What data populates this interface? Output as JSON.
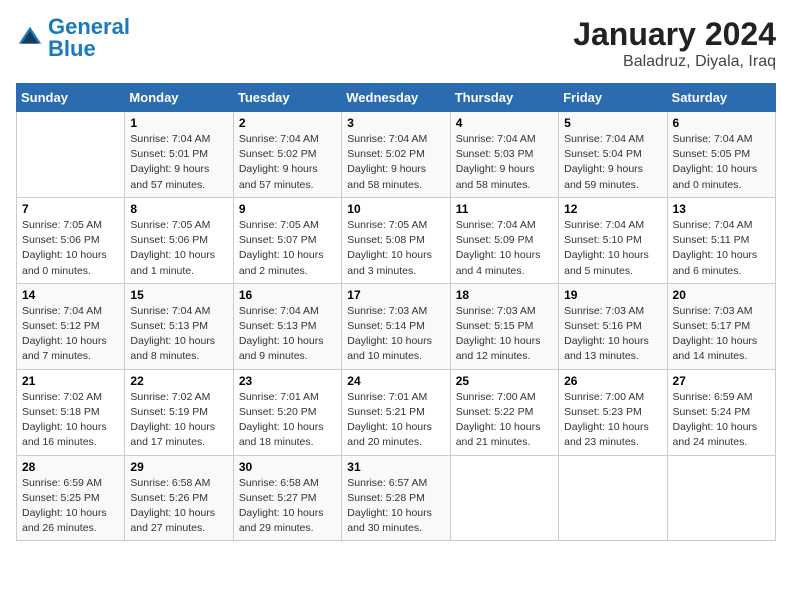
{
  "header": {
    "logo_general": "General",
    "logo_blue": "Blue",
    "title": "January 2024",
    "subtitle": "Baladruz, Diyala, Iraq"
  },
  "days_of_week": [
    "Sunday",
    "Monday",
    "Tuesday",
    "Wednesday",
    "Thursday",
    "Friday",
    "Saturday"
  ],
  "weeks": [
    [
      {
        "day": "",
        "info": ""
      },
      {
        "day": "1",
        "info": "Sunrise: 7:04 AM\nSunset: 5:01 PM\nDaylight: 9 hours\nand 57 minutes."
      },
      {
        "day": "2",
        "info": "Sunrise: 7:04 AM\nSunset: 5:02 PM\nDaylight: 9 hours\nand 57 minutes."
      },
      {
        "day": "3",
        "info": "Sunrise: 7:04 AM\nSunset: 5:02 PM\nDaylight: 9 hours\nand 58 minutes."
      },
      {
        "day": "4",
        "info": "Sunrise: 7:04 AM\nSunset: 5:03 PM\nDaylight: 9 hours\nand 58 minutes."
      },
      {
        "day": "5",
        "info": "Sunrise: 7:04 AM\nSunset: 5:04 PM\nDaylight: 9 hours\nand 59 minutes."
      },
      {
        "day": "6",
        "info": "Sunrise: 7:04 AM\nSunset: 5:05 PM\nDaylight: 10 hours\nand 0 minutes."
      }
    ],
    [
      {
        "day": "7",
        "info": "Sunrise: 7:05 AM\nSunset: 5:06 PM\nDaylight: 10 hours\nand 0 minutes."
      },
      {
        "day": "8",
        "info": "Sunrise: 7:05 AM\nSunset: 5:06 PM\nDaylight: 10 hours\nand 1 minute."
      },
      {
        "day": "9",
        "info": "Sunrise: 7:05 AM\nSunset: 5:07 PM\nDaylight: 10 hours\nand 2 minutes."
      },
      {
        "day": "10",
        "info": "Sunrise: 7:05 AM\nSunset: 5:08 PM\nDaylight: 10 hours\nand 3 minutes."
      },
      {
        "day": "11",
        "info": "Sunrise: 7:04 AM\nSunset: 5:09 PM\nDaylight: 10 hours\nand 4 minutes."
      },
      {
        "day": "12",
        "info": "Sunrise: 7:04 AM\nSunset: 5:10 PM\nDaylight: 10 hours\nand 5 minutes."
      },
      {
        "day": "13",
        "info": "Sunrise: 7:04 AM\nSunset: 5:11 PM\nDaylight: 10 hours\nand 6 minutes."
      }
    ],
    [
      {
        "day": "14",
        "info": "Sunrise: 7:04 AM\nSunset: 5:12 PM\nDaylight: 10 hours\nand 7 minutes."
      },
      {
        "day": "15",
        "info": "Sunrise: 7:04 AM\nSunset: 5:13 PM\nDaylight: 10 hours\nand 8 minutes."
      },
      {
        "day": "16",
        "info": "Sunrise: 7:04 AM\nSunset: 5:13 PM\nDaylight: 10 hours\nand 9 minutes."
      },
      {
        "day": "17",
        "info": "Sunrise: 7:03 AM\nSunset: 5:14 PM\nDaylight: 10 hours\nand 10 minutes."
      },
      {
        "day": "18",
        "info": "Sunrise: 7:03 AM\nSunset: 5:15 PM\nDaylight: 10 hours\nand 12 minutes."
      },
      {
        "day": "19",
        "info": "Sunrise: 7:03 AM\nSunset: 5:16 PM\nDaylight: 10 hours\nand 13 minutes."
      },
      {
        "day": "20",
        "info": "Sunrise: 7:03 AM\nSunset: 5:17 PM\nDaylight: 10 hours\nand 14 minutes."
      }
    ],
    [
      {
        "day": "21",
        "info": "Sunrise: 7:02 AM\nSunset: 5:18 PM\nDaylight: 10 hours\nand 16 minutes."
      },
      {
        "day": "22",
        "info": "Sunrise: 7:02 AM\nSunset: 5:19 PM\nDaylight: 10 hours\nand 17 minutes."
      },
      {
        "day": "23",
        "info": "Sunrise: 7:01 AM\nSunset: 5:20 PM\nDaylight: 10 hours\nand 18 minutes."
      },
      {
        "day": "24",
        "info": "Sunrise: 7:01 AM\nSunset: 5:21 PM\nDaylight: 10 hours\nand 20 minutes."
      },
      {
        "day": "25",
        "info": "Sunrise: 7:00 AM\nSunset: 5:22 PM\nDaylight: 10 hours\nand 21 minutes."
      },
      {
        "day": "26",
        "info": "Sunrise: 7:00 AM\nSunset: 5:23 PM\nDaylight: 10 hours\nand 23 minutes."
      },
      {
        "day": "27",
        "info": "Sunrise: 6:59 AM\nSunset: 5:24 PM\nDaylight: 10 hours\nand 24 minutes."
      }
    ],
    [
      {
        "day": "28",
        "info": "Sunrise: 6:59 AM\nSunset: 5:25 PM\nDaylight: 10 hours\nand 26 minutes."
      },
      {
        "day": "29",
        "info": "Sunrise: 6:58 AM\nSunset: 5:26 PM\nDaylight: 10 hours\nand 27 minutes."
      },
      {
        "day": "30",
        "info": "Sunrise: 6:58 AM\nSunset: 5:27 PM\nDaylight: 10 hours\nand 29 minutes."
      },
      {
        "day": "31",
        "info": "Sunrise: 6:57 AM\nSunset: 5:28 PM\nDaylight: 10 hours\nand 30 minutes."
      },
      {
        "day": "",
        "info": ""
      },
      {
        "day": "",
        "info": ""
      },
      {
        "day": "",
        "info": ""
      }
    ]
  ]
}
